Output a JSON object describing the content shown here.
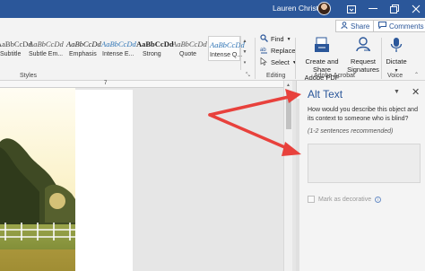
{
  "titlebar": {
    "user_name": "Lauren Christoff"
  },
  "ribbon": {
    "share_label": "Share",
    "comments_label": "Comments",
    "styles": [
      {
        "sample": "AaBbCcDd",
        "label": "Subtitle"
      },
      {
        "sample": "AaBbCcDd",
        "label": "Subtle Em..."
      },
      {
        "sample": "AaBbCcDd",
        "label": "Emphasis"
      },
      {
        "sample": "AaBbCcDd",
        "label": "Intense E..."
      },
      {
        "sample": "AaBbCcDd",
        "label": "Strong"
      },
      {
        "sample": "AaBbCcDd",
        "label": "Quote"
      },
      {
        "sample": "AaBbCcDd",
        "label": "Intense Q..."
      }
    ],
    "styles_group_label": "Styles",
    "editing": {
      "find_label": "Find",
      "replace_label": "Replace",
      "select_label": "Select",
      "group_label": "Editing"
    },
    "adobe": {
      "create_label_line1": "Create and Share",
      "create_label_line2": "Adobe PDF",
      "request_label_line1": "Request",
      "request_label_line2": "Signatures",
      "group_label": "Adobe Acrobat"
    },
    "voice": {
      "dictate_label": "Dictate",
      "group_label": "Voice"
    }
  },
  "ruler": {
    "mark": "7"
  },
  "alt_text_pane": {
    "title": "Alt Text",
    "description": "How would you describe this object and its context to someone who is blind?",
    "recommendation": "(1-2 sentences recommended)",
    "textarea_value": "",
    "decorative_label": "Mark as decorative"
  },
  "colors": {
    "titlebar": "#2b579a",
    "annotation_arrow": "#e8413c"
  }
}
